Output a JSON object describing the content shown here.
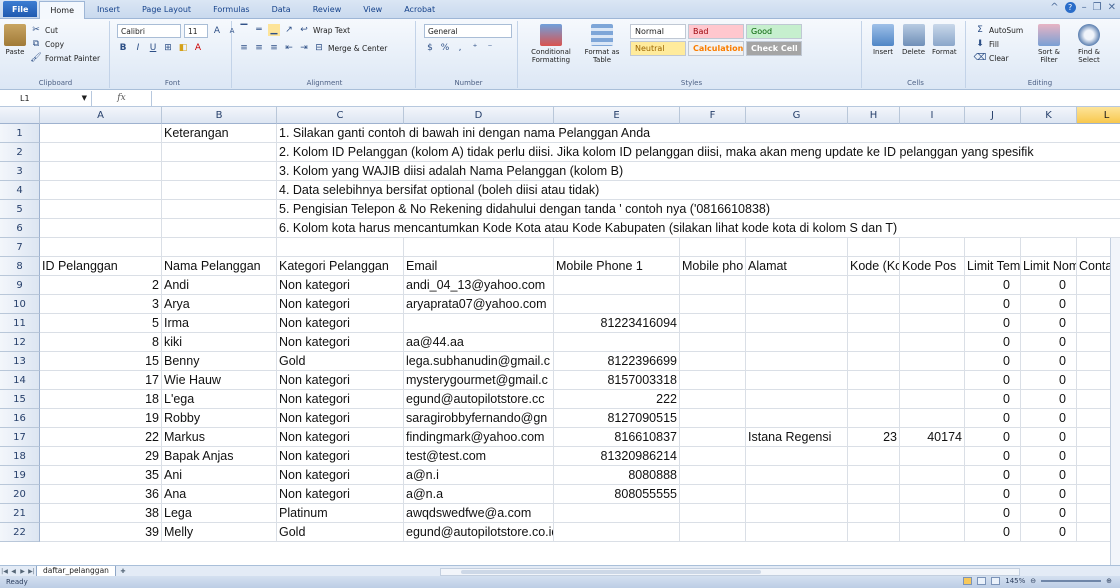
{
  "ribbon": {
    "tabs": [
      "File",
      "Home",
      "Insert",
      "Page Layout",
      "Formulas",
      "Data",
      "Review",
      "View",
      "Acrobat"
    ],
    "active_tab": "Home",
    "clipboard": {
      "paste": "Paste",
      "cut": "Cut",
      "copy": "Copy",
      "format_painter": "Format Painter",
      "label": "Clipboard"
    },
    "font": {
      "name": "Calibri",
      "size": "11",
      "label": "Font"
    },
    "alignment": {
      "wrap": "Wrap Text",
      "merge": "Merge & Center",
      "label": "Alignment"
    },
    "number": {
      "format": "General",
      "label": "Number"
    },
    "styles": {
      "conditional": "Conditional Formatting",
      "format_table": "Format as Table",
      "normal": "Normal",
      "bad": "Bad",
      "good": "Good",
      "neutral": "Neutral",
      "calculation": "Calculation",
      "check_cell": "Check Cell",
      "label": "Styles"
    },
    "cells": {
      "insert": "Insert",
      "delete": "Delete",
      "format": "Format",
      "label": "Cells"
    },
    "editing": {
      "autosum": "AutoSum",
      "fill": "Fill",
      "clear": "Clear",
      "sort": "Sort & Filter",
      "find": "Find & Select",
      "label": "Editing"
    }
  },
  "formula_bar": {
    "name_box": "L1",
    "fx": "fx",
    "value": ""
  },
  "columns": [
    "A",
    "B",
    "C",
    "D",
    "E",
    "F",
    "G",
    "H",
    "I",
    "J",
    "K",
    "L"
  ],
  "selected_column": "L",
  "row_numbers": [
    "1",
    "2",
    "3",
    "4",
    "5",
    "6",
    "7",
    "8",
    "9",
    "10",
    "11",
    "12",
    "13",
    "14",
    "15",
    "16",
    "17",
    "18",
    "19",
    "20",
    "21",
    "22"
  ],
  "notes": {
    "label": "Keterangan",
    "lines": [
      "1. Silakan ganti contoh di bawah ini dengan nama Pelanggan Anda",
      "2. Kolom ID Pelanggan (kolom A) tidak perlu diisi. Jika kolom ID pelanggan diisi, maka akan meng update ke ID pelanggan yang spesifik",
      "3. Kolom yang WAJIB diisi adalah Nama Pelanggan (kolom B)",
      "4. Data selebihnya bersifat optional (boleh diisi atau tidak)",
      "5. Pengisian Telepon & No Rekening didahului dengan tanda ' contoh nya ('0816610838)",
      "6. Kolom kota harus mencantumkan Kode Kota atau Kode Kabupaten (silakan lihat kode kota di kolom S dan T)"
    ]
  },
  "headers": [
    "ID Pelanggan",
    "Nama Pelanggan",
    "Kategori Pelanggan",
    "Email",
    "Mobile Phone 1",
    "Mobile pho",
    "Alamat",
    "Kode (Kota",
    "Kode Pos",
    "Limit Temp",
    "Limit Nom",
    "Conta"
  ],
  "rows": [
    [
      "2",
      "Andi",
      "Non kategori",
      "andi_04_13@yahoo.com",
      "",
      "",
      "",
      "",
      "",
      "0",
      "0"
    ],
    [
      "3",
      "Arya",
      "Non kategori",
      "aryaprata07@yahoo.com",
      "",
      "",
      "",
      "",
      "",
      "0",
      "0"
    ],
    [
      "5",
      "Irma",
      "Non kategori",
      "",
      "81223416094",
      "",
      "",
      "",
      "",
      "0",
      "0"
    ],
    [
      "8",
      "kiki",
      "Non kategori",
      "aa@44.aa",
      "",
      "",
      "",
      "",
      "",
      "0",
      "0"
    ],
    [
      "15",
      "Benny",
      "Gold",
      "lega.subhanudin@gmail.c",
      "8122396699",
      "",
      "",
      "",
      "",
      "0",
      "0"
    ],
    [
      "17",
      "Wie Hauw",
      "Non kategori",
      "mysterygourmet@gmail.c",
      "8157003318",
      "",
      "",
      "",
      "",
      "0",
      "0"
    ],
    [
      "18",
      "L'ega",
      "Non kategori",
      "egund@autopilotstore.cc",
      "222",
      "",
      "",
      "",
      "",
      "0",
      "0"
    ],
    [
      "19",
      "Robby",
      "Non kategori",
      "saragirobbyfernando@gn",
      "8127090515",
      "",
      "",
      "",
      "",
      "0",
      "0"
    ],
    [
      "22",
      "Markus",
      "Non kategori",
      "findingmark@yahoo.com",
      "816610837",
      "",
      "Istana Regensi",
      "23",
      "40174",
      "0",
      "0"
    ],
    [
      "29",
      "Bapak Anjas",
      "Non kategori",
      "test@test.com",
      "81320986214",
      "",
      "",
      "",
      "",
      "0",
      "0"
    ],
    [
      "35",
      "Ani",
      "Non kategori",
      "a@n.i",
      "8080888",
      "",
      "",
      "",
      "",
      "0",
      "0"
    ],
    [
      "36",
      "Ana",
      "Non kategori",
      "a@n.a",
      "808055555",
      "",
      "",
      "",
      "",
      "0",
      "0"
    ],
    [
      "38",
      "Lega",
      "Platinum",
      "awqdswedfwe@a.com",
      "",
      "",
      "",
      "",
      "",
      "0",
      "0"
    ],
    [
      "39",
      "Melly",
      "Gold",
      "egund@autopilotstore.co.id",
      "",
      "",
      "",
      "",
      "",
      "0",
      "0"
    ]
  ],
  "sheet_tab": "daftar_pelanggan",
  "status": {
    "ready": "Ready",
    "zoom": "145%"
  }
}
